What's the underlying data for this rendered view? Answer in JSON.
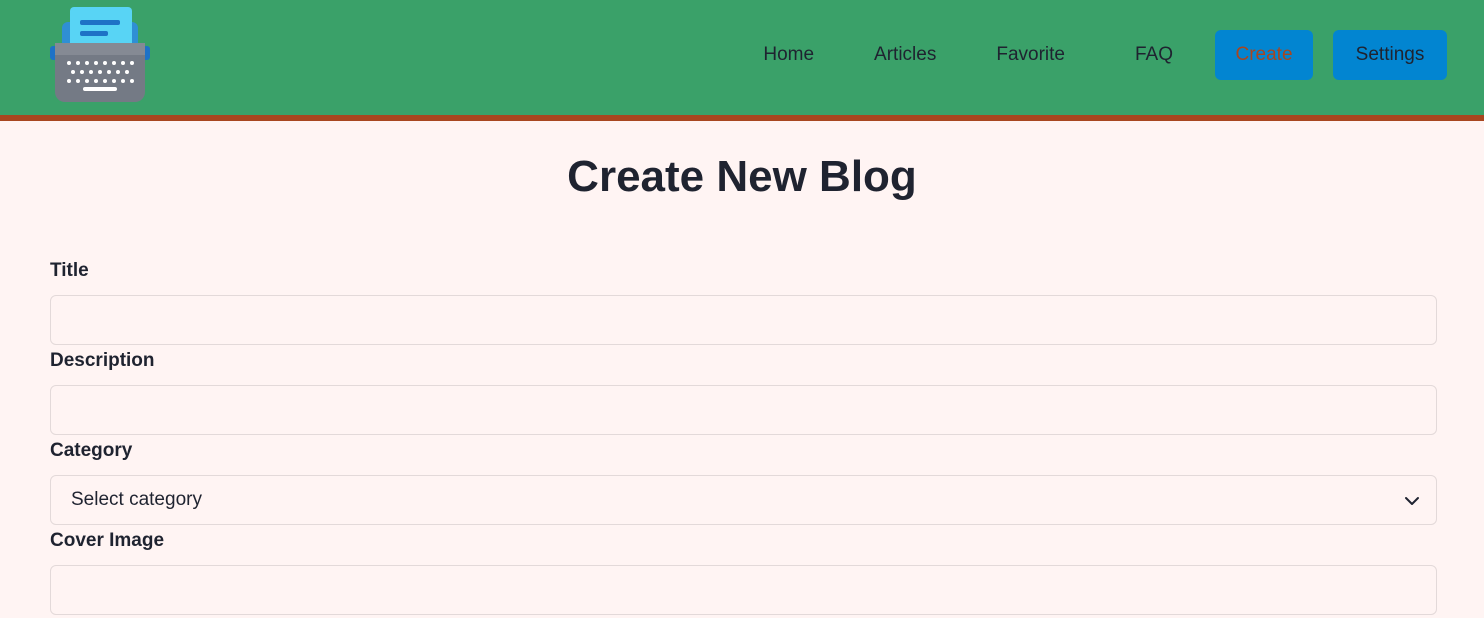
{
  "nav": {
    "links": [
      "Home",
      "Articles",
      "Favorite",
      "FAQ"
    ],
    "create_label": "Create",
    "settings_label": "Settings"
  },
  "page": {
    "title": "Create New Blog"
  },
  "form": {
    "title_label": "Title",
    "title_value": "",
    "description_label": "Description",
    "description_value": "",
    "category_label": "Category",
    "category_value": "Select category",
    "cover_label": "Cover Image",
    "cover_value": ""
  },
  "colors": {
    "navbar": "#3aa169",
    "navbar_border": "#a8461f",
    "button": "#0285d1",
    "background": "#fff4f3"
  },
  "icons": {
    "logo": "typewriter-icon",
    "select": "chevron-down-icon"
  }
}
